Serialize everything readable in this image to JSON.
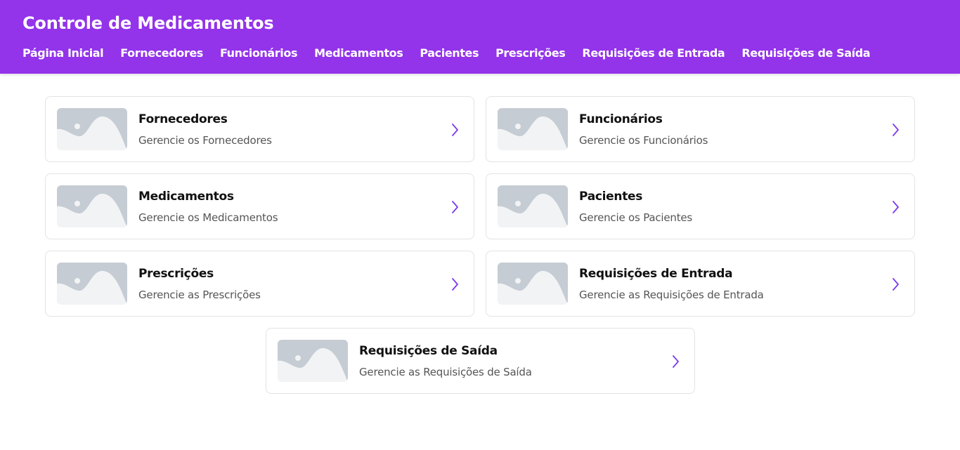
{
  "header": {
    "title": "Controle de Medicamentos",
    "nav": [
      "Página Inicial",
      "Fornecedores",
      "Funcionários",
      "Medicamentos",
      "Pacientes",
      "Prescrições",
      "Requisições de Entrada",
      "Requisições de Saída"
    ]
  },
  "cards": [
    {
      "title": "Fornecedores",
      "subtitle": "Gerencie os Fornecedores"
    },
    {
      "title": "Funcionários",
      "subtitle": "Gerencie os Funcionários"
    },
    {
      "title": "Medicamentos",
      "subtitle": "Gerencie os Medicamentos"
    },
    {
      "title": "Pacientes",
      "subtitle": "Gerencie os Pacientes"
    },
    {
      "title": "Prescrições",
      "subtitle": "Gerencie as Prescrições"
    },
    {
      "title": "Requisições de Entrada",
      "subtitle": "Gerencie as Requisições de Entrada"
    },
    {
      "title": "Requisições de Saída",
      "subtitle": "Gerencie as Requisições de Saída"
    }
  ],
  "icons": {
    "thumbnail": "image-placeholder-icon",
    "chevron": "chevron-right-icon"
  },
  "colors": {
    "brand": "#9333ea",
    "chevron": "#7c3aed",
    "placeholder_bg": "#f2f3f5",
    "placeholder_fg": "#c5ccd3"
  }
}
